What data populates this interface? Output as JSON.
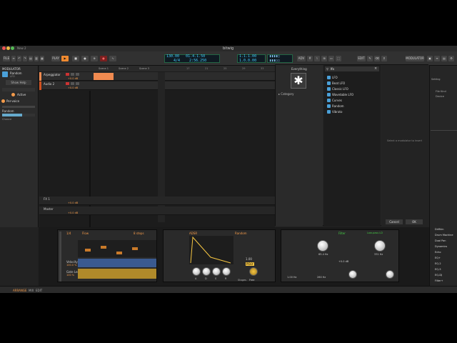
{
  "window_title": "New 2",
  "logo": "bitwig",
  "toolbar": {
    "file": "FILE",
    "play": "PLAY",
    "tempo": "130.00",
    "signature": "4/4",
    "position": "01.4.1.50",
    "time": "2:56.250",
    "loop_pos": "1.1.1.00",
    "loop_len": "1.0.0.00",
    "adv": "ADV",
    "edit": "EDIT",
    "modulator_btn": "MODULATOR"
  },
  "left_panel": {
    "header": "MODULATOR",
    "device_name": "Random",
    "device_sub": "LFO",
    "show_help": "Show Help",
    "active": "Active",
    "per_voice": "Per-voice",
    "random_label": "Random",
    "param": "Chance"
  },
  "scenes": [
    "Scene 1",
    "Scene 2",
    "Scene 3"
  ],
  "tracks": [
    {
      "name": "Arpeggiator",
      "vol": "+0.0 dB",
      "color": "#f08a50"
    },
    {
      "name": "Audio 2",
      "vol": "+0.0 dB",
      "color": "#d05020"
    }
  ],
  "bus_tracks": [
    {
      "name": "FX 1",
      "vol": "+0.0 dB"
    },
    {
      "name": "Master",
      "vol": "+0.0 dB"
    }
  ],
  "timeline": [
    "17",
    "21",
    "25",
    "29",
    "33",
    "37"
  ],
  "browser": {
    "everything": "Everything",
    "category": "Category",
    "search": "lfo",
    "close": "×",
    "items": [
      "LFO",
      "Beat LFO",
      "Classic LFO",
      "Wavetable LFO",
      "Curves",
      "Random",
      "Vibrato"
    ],
    "hint": "Select a modulator to insert",
    "cancel": "Cancel",
    "ok": "OK"
  },
  "right_panel": {
    "tab": "Setting",
    "items_top": [
      "File Kind",
      "Device"
    ],
    "items_bottom": [
      "Drifikin",
      "Drum Machine",
      "Dual Pan",
      "Dynamics",
      "Echo",
      "EQ+",
      "EQ-2",
      "EQ-5",
      "EQ-DJ",
      "Filter+"
    ]
  },
  "devices": {
    "arp": {
      "title": "ARPEGGIATOR",
      "rate": "1/4",
      "mode": "Flow",
      "steps": "8 steps",
      "velocity": "Velocity",
      "vel_val": "100.0 %",
      "gate": "Gate Len.",
      "gate_val": "100 %"
    },
    "sampler": {
      "title": "SAMPLER",
      "adsr": "ADSR",
      "random": "Random",
      "knob_labels": [
        "A",
        "D",
        "S",
        "R"
      ],
      "freq": "1.00",
      "poly": "POLY",
      "stages": "Stages",
      "free": "Free"
    },
    "filter": {
      "title": "Filter",
      "fx_label": "Low-pass LD",
      "freq1": "65.4 Hz",
      "freq2": "331 Hz",
      "gain": "+0.0 dB",
      "rate": "1.00 Hz",
      "hz2": "260 Hz"
    }
  },
  "status": {
    "arrange": "ARRANGE",
    "mix": "MIX",
    "edit": "EDIT"
  }
}
